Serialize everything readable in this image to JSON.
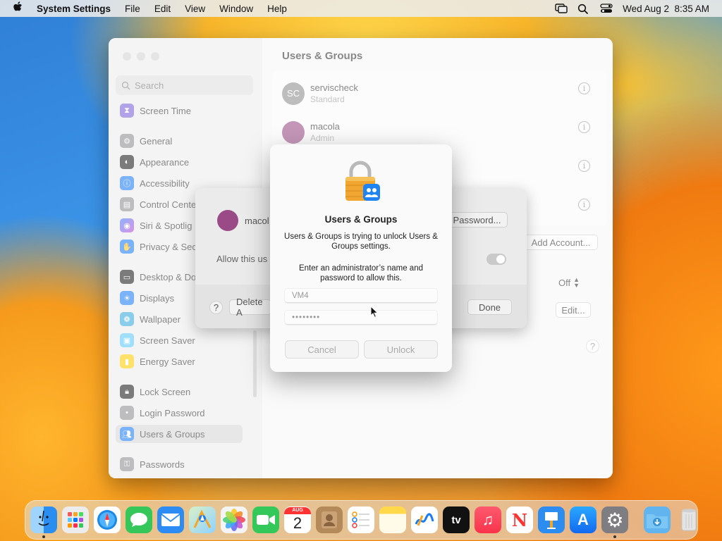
{
  "menubar": {
    "app_name": "System Settings",
    "menus": [
      "File",
      "Edit",
      "View",
      "Window",
      "Help"
    ],
    "datetime": "Wed Aug 2  8:35 AM"
  },
  "window": {
    "title": "Users & Groups",
    "search_placeholder": "Search",
    "sidebar": [
      {
        "label": "Screen Time",
        "icon": "hourglass-icon",
        "color": "#7b61d8"
      },
      {
        "label": "General",
        "icon": "gear-icon",
        "color": "#8e8e93"
      },
      {
        "label": "Appearance",
        "icon": "appearance-icon",
        "color": "#1c1c1e"
      },
      {
        "label": "Accessibility",
        "icon": "accessibility-icon",
        "color": "#1a7cf5"
      },
      {
        "label": "Control Cente",
        "icon": "control-center-icon",
        "color": "#8e8e93"
      },
      {
        "label": "Siri & Spotlig",
        "icon": "siri-icon",
        "color": "#c045d8"
      },
      {
        "label": "Privacy & Sec",
        "icon": "hand-icon",
        "color": "#1a7cf5"
      },
      {
        "label": "Desktop & Do",
        "icon": "desktop-icon",
        "color": "#1c1c1e"
      },
      {
        "label": "Displays",
        "icon": "displays-icon",
        "color": "#1a7cf5"
      },
      {
        "label": "Wallpaper",
        "icon": "wallpaper-icon",
        "color": "#36aadc"
      },
      {
        "label": "Screen Saver",
        "icon": "screen-saver-icon",
        "color": "#5ac8fa"
      },
      {
        "label": "Energy Saver",
        "icon": "battery-icon",
        "color": "#ffcc00"
      },
      {
        "label": "Lock Screen",
        "icon": "lock-icon",
        "color": "#1c1c1e"
      },
      {
        "label": "Login Password",
        "icon": "login-password-icon",
        "color": "#8e8e93"
      },
      {
        "label": "Users & Groups",
        "icon": "users-icon",
        "color": "#1a7cf5"
      },
      {
        "label": "Passwords",
        "icon": "key-icon",
        "color": "#8e8e93"
      }
    ],
    "users": [
      {
        "initials": "SC",
        "name": "servischeck",
        "role": "Standard"
      },
      {
        "initials": "",
        "name": "macola",
        "role": "Admin"
      }
    ],
    "buttons": {
      "password": "Password...",
      "add_account": "Add Account...",
      "off_select": "Off",
      "edit": "Edit...",
      "help": "?"
    }
  },
  "sheet": {
    "user_name": "macol",
    "allow_label": "Allow this us",
    "help": "?",
    "delete_label": "Delete A",
    "done_label": "Done"
  },
  "dialog": {
    "title": "Users & Groups",
    "message": "Users & Groups is trying to unlock Users & Groups settings.",
    "prompt": "Enter an administrator’s name and password to allow this.",
    "username_value": "VM4",
    "password_value": "••••••••",
    "cancel_label": "Cancel",
    "unlock_label": "Unlock"
  },
  "dock": [
    {
      "name": "finder",
      "label": "",
      "color": "#2a8ef0",
      "running": true
    },
    {
      "name": "launchpad",
      "label": "",
      "color": "#ececec",
      "running": false
    },
    {
      "name": "safari",
      "label": "",
      "color": "#1e88e5",
      "running": false
    },
    {
      "name": "messages",
      "label": "",
      "color": "#35c759",
      "running": false
    },
    {
      "name": "mail",
      "label": "",
      "color": "#2c8cf4",
      "running": false
    },
    {
      "name": "maps",
      "label": "",
      "color": "#5fc36a",
      "running": false
    },
    {
      "name": "photos",
      "label": "",
      "color": "#f4f4f4",
      "running": false
    },
    {
      "name": "facetime",
      "label": "",
      "color": "#34c759",
      "running": false
    },
    {
      "name": "calendar",
      "label": "2",
      "sub": "AUG",
      "color": "#ffffff",
      "running": false
    },
    {
      "name": "contacts",
      "label": "",
      "color": "#b58a5a",
      "running": false
    },
    {
      "name": "reminders",
      "label": "",
      "color": "#ffffff",
      "running": false
    },
    {
      "name": "notes",
      "label": "",
      "color": "#fff2a8",
      "running": false
    },
    {
      "name": "freeform",
      "label": "",
      "color": "#ffffff",
      "running": false
    },
    {
      "name": "apple-tv",
      "label": "tv",
      "color": "#111111",
      "running": false
    },
    {
      "name": "music",
      "label": "♫",
      "color": "#fa3c51",
      "running": false
    },
    {
      "name": "news",
      "label": "N",
      "color": "#ffffff",
      "running": false
    },
    {
      "name": "keynote",
      "label": "",
      "color": "#2d8cf0",
      "running": false
    },
    {
      "name": "app-store",
      "label": "A",
      "color": "#1c8ef5",
      "running": false
    },
    {
      "name": "system-settings",
      "label": "⚙",
      "color": "#7d7d82",
      "running": true
    }
  ],
  "dock_right": [
    {
      "name": "downloads-folder",
      "color": "#62b4ee"
    },
    {
      "name": "trash",
      "color": "#dcdcdc"
    }
  ]
}
